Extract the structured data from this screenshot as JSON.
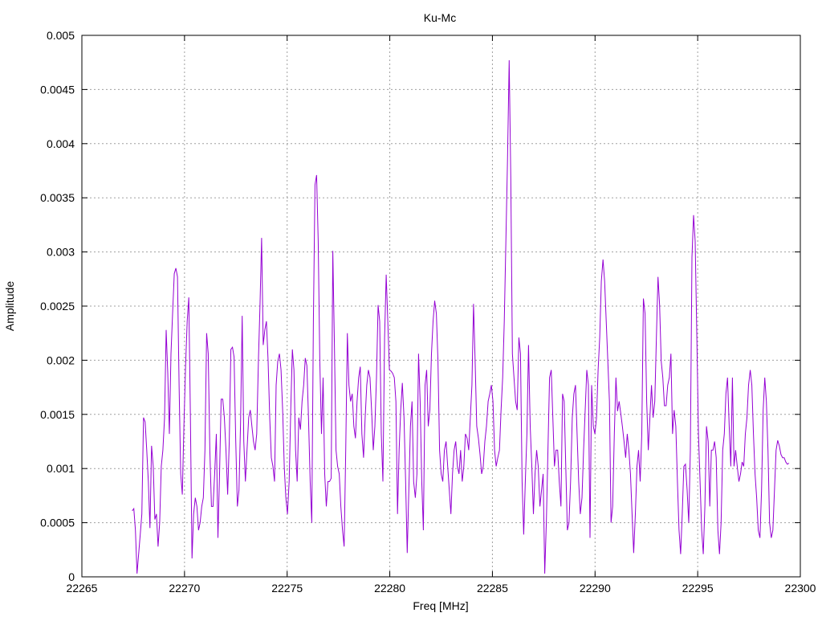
{
  "chart_data": {
    "type": "line",
    "title": "Ku-Mc",
    "xlabel": "Freq [MHz]",
    "ylabel": "Amplitude",
    "xlim": [
      22265,
      22300
    ],
    "ylim": [
      0,
      0.005
    ],
    "xticks": [
      22265,
      22270,
      22275,
      22280,
      22285,
      22290,
      22295,
      22300
    ],
    "xtick_labels": [
      "22265",
      "22270",
      "22275",
      "22280",
      "22285",
      "22290",
      "22295",
      "22300"
    ],
    "yticks": [
      0,
      0.0005,
      0.001,
      0.0015,
      0.002,
      0.0025,
      0.003,
      0.0035,
      0.004,
      0.0045,
      0.005
    ],
    "ytick_labels": [
      "0",
      "0.0005",
      "0.001",
      "0.0015",
      "0.002",
      "0.0025",
      "0.003",
      "0.0035",
      "0.004",
      "0.0045",
      "0.005"
    ],
    "grid": true,
    "legend": "none",
    "series": [
      {
        "name": "Ku-Mc",
        "color": "#9400d3",
        "x_start": 22267.45,
        "x_end": 22299.45,
        "values": [
          0.00061,
          0.00063,
          0.00043,
          3e-05,
          0.00021,
          0.00039,
          0.00058,
          0.00147,
          0.00143,
          0.00117,
          0.00088,
          0.00045,
          0.00121,
          0.00102,
          0.00053,
          0.00058,
          0.00028,
          0.0005,
          0.00102,
          0.00117,
          0.00147,
          0.00228,
          0.00188,
          0.00132,
          0.00206,
          0.00243,
          0.0028,
          0.00285,
          0.00277,
          0.00177,
          0.00095,
          0.00076,
          0.00139,
          0.00195,
          0.00236,
          0.00258,
          0.00147,
          0.00017,
          0.00058,
          0.00073,
          0.00065,
          0.00043,
          0.0005,
          0.00065,
          0.00073,
          0.00117,
          0.00225,
          0.00206,
          0.00117,
          0.00065,
          0.00065,
          0.00095,
          0.00132,
          0.00036,
          0.00095,
          0.00164,
          0.00164,
          0.00147,
          0.00117,
          0.00076,
          0.00125,
          0.0021,
          0.00212,
          0.00203,
          0.00128,
          0.00065,
          0.0008,
          0.00143,
          0.00241,
          0.00125,
          0.00088,
          0.00117,
          0.00147,
          0.00154,
          0.00139,
          0.00125,
          0.00117,
          0.00132,
          0.00199,
          0.00251,
          0.00313,
          0.00214,
          0.00228,
          0.00236,
          0.00199,
          0.00147,
          0.0011,
          0.00102,
          0.00088,
          0.00177,
          0.00199,
          0.00206,
          0.00191,
          0.00154,
          0.00102,
          0.00073,
          0.00058,
          0.00088,
          0.00154,
          0.0021,
          0.00191,
          0.00117,
          0.00088,
          0.00147,
          0.00136,
          0.00162,
          0.00177,
          0.00202,
          0.00195,
          0.00147,
          0.00088,
          0.0005,
          0.00236,
          0.00362,
          0.00371,
          0.0031,
          0.00199,
          0.00132,
          0.00184,
          0.00095,
          0.00065,
          0.00088,
          0.00088,
          0.00091,
          0.00301,
          0.00214,
          0.00117,
          0.00102,
          0.00095,
          0.00065,
          0.00043,
          0.00028,
          0.00117,
          0.00225,
          0.00177,
          0.00162,
          0.00169,
          0.00139,
          0.00128,
          0.00162,
          0.00184,
          0.00194,
          0.00132,
          0.0011,
          0.00147,
          0.00177,
          0.00191,
          0.00184,
          0.00154,
          0.00117,
          0.00139,
          0.00184,
          0.00251,
          0.00236,
          0.00132,
          0.00088,
          0.00221,
          0.00279,
          0.00236,
          0.00191,
          0.0019,
          0.00188,
          0.00184,
          0.00162,
          0.00058,
          0.00117,
          0.00154,
          0.00179,
          0.00147,
          0.00088,
          0.00022,
          0.0008,
          0.00139,
          0.00162,
          0.00088,
          0.00073,
          0.00095,
          0.00206,
          0.00162,
          0.00088,
          0.00043,
          0.00177,
          0.00191,
          0.00139,
          0.00154,
          0.00206,
          0.00236,
          0.00255,
          0.00243,
          0.00199,
          0.00117,
          0.00095,
          0.00088,
          0.00117,
          0.00125,
          0.00102,
          0.0008,
          0.00058,
          0.00095,
          0.00117,
          0.00125,
          0.00102,
          0.00095,
          0.00117,
          0.00088,
          0.00102,
          0.00132,
          0.00128,
          0.00117,
          0.00147,
          0.00177,
          0.00252,
          0.00199,
          0.00139,
          0.00128,
          0.00113,
          0.00095,
          0.00102,
          0.00125,
          0.00139,
          0.00162,
          0.00169,
          0.00177,
          0.00162,
          0.00117,
          0.00102,
          0.0011,
          0.00117,
          0.00154,
          0.00184,
          0.00236,
          0.0031,
          0.00384,
          0.00477,
          0.00369,
          0.00206,
          0.00184,
          0.00162,
          0.00154,
          0.00221,
          0.00206,
          0.00088,
          0.00039,
          0.00088,
          0.00132,
          0.00214,
          0.00139,
          0.00102,
          0.00058,
          0.00095,
          0.00117,
          0.00102,
          0.00065,
          0.0008,
          0.00095,
          3e-05,
          0.0005,
          0.00117,
          0.00184,
          0.00191,
          0.00147,
          0.00102,
          0.00117,
          0.00117,
          0.00088,
          0.00065,
          0.00169,
          0.00162,
          0.00102,
          0.00043,
          0.0005,
          0.00088,
          0.00147,
          0.00169,
          0.00177,
          0.00132,
          0.00088,
          0.00058,
          0.00073,
          0.00117,
          0.00154,
          0.00191,
          0.00177,
          0.00036,
          0.00177,
          0.00139,
          0.00132,
          0.00147,
          0.00191,
          0.00221,
          0.00273,
          0.00293,
          0.00273,
          0.00236,
          0.00199,
          0.00162,
          0.0005,
          0.00065,
          0.00132,
          0.00184,
          0.00153,
          0.00162,
          0.00151,
          0.00139,
          0.00125,
          0.0011,
          0.00132,
          0.00117,
          0.00095,
          0.00058,
          0.00022,
          0.00058,
          0.00102,
          0.00117,
          0.00088,
          0.00132,
          0.00257,
          0.00243,
          0.00162,
          0.00117,
          0.00147,
          0.00177,
          0.00147,
          0.00162,
          0.00221,
          0.00277,
          0.00251,
          0.00199,
          0.00184,
          0.00158,
          0.00158,
          0.00177,
          0.00184,
          0.00206,
          0.00132,
          0.00154,
          0.00139,
          0.00088,
          0.00043,
          0.00021,
          0.00058,
          0.00102,
          0.00104,
          0.0008,
          0.0005,
          0.00117,
          0.00295,
          0.00334,
          0.0031,
          0.00221,
          0.00132,
          0.00088,
          0.00043,
          0.00021,
          0.00065,
          0.00139,
          0.00125,
          0.00065,
          0.00117,
          0.00117,
          0.00125,
          0.0011,
          0.00043,
          0.00021,
          0.0005,
          0.00117,
          0.00132,
          0.00169,
          0.00184,
          0.00139,
          0.00102,
          0.00184,
          0.00102,
          0.00117,
          0.00102,
          0.00088,
          0.00095,
          0.00106,
          0.00102,
          0.00132,
          0.00147,
          0.00177,
          0.00191,
          0.00177,
          0.00132,
          0.00095,
          0.00073,
          0.00043,
          0.00036,
          0.0008,
          0.00154,
          0.00184,
          0.00162,
          0.00117,
          0.0005,
          0.00036,
          0.00043,
          0.0008,
          0.00117,
          0.00126,
          0.00121,
          0.00113,
          0.0011,
          0.0011,
          0.00106,
          0.00104,
          0.00105
        ]
      }
    ]
  }
}
